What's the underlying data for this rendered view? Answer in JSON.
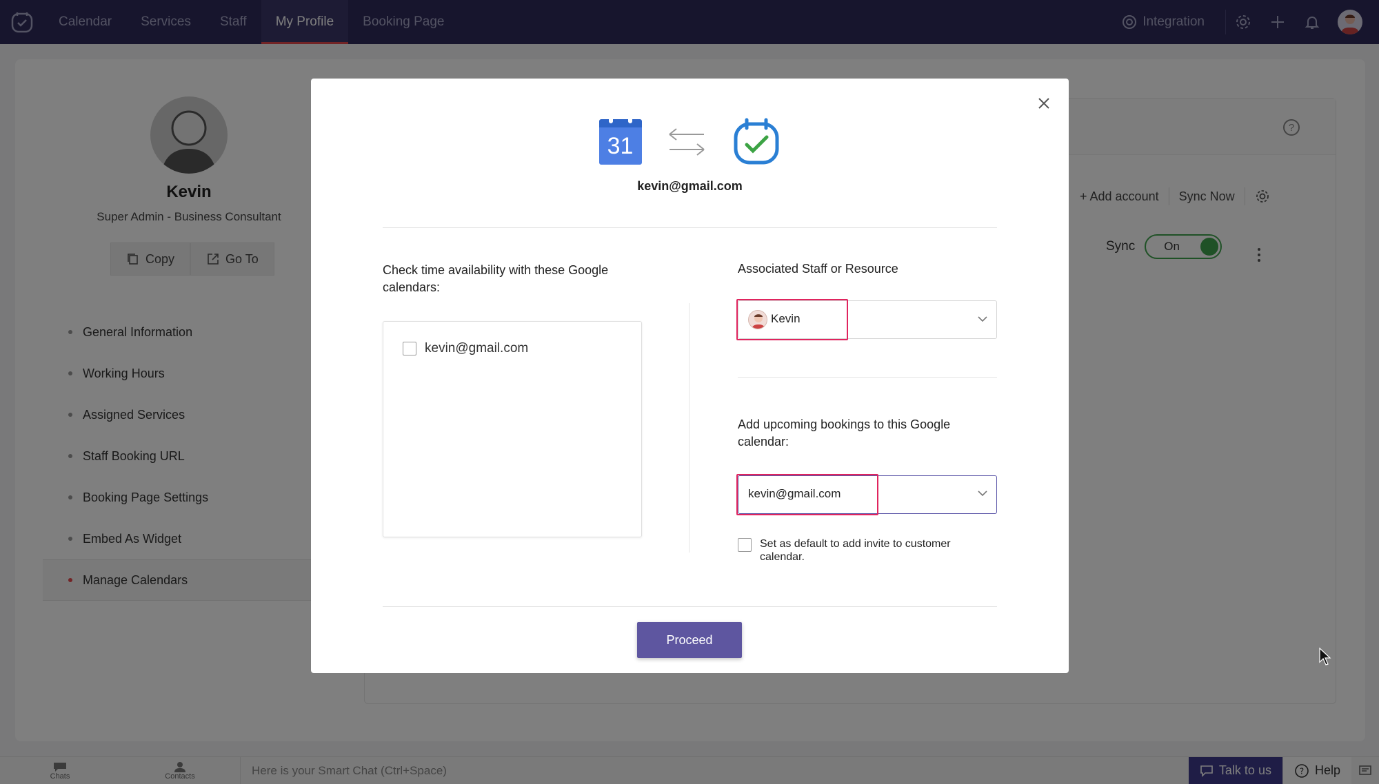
{
  "topnav": {
    "tabs": [
      "Calendar",
      "Services",
      "Staff",
      "My Profile",
      "Booking Page"
    ],
    "active_tab": "My Profile",
    "integration_label": "Integration",
    "icons": [
      "app-logo-icon",
      "integration-icon",
      "gear-icon",
      "plus-icon",
      "bell-icon",
      "avatar"
    ]
  },
  "profile": {
    "name": "Kevin",
    "role": "Super Admin - Business Consultant",
    "copy_label": "Copy",
    "goto_label": "Go To"
  },
  "menu": {
    "items": [
      "General Information",
      "Working Hours",
      "Assigned Services",
      "Staff Booking URL",
      "Booking Page Settings",
      "Embed As Widget",
      "Manage Calendars"
    ],
    "active": "Manage Calendars"
  },
  "calendars_panel": {
    "help_glyph": "?",
    "add_account": "+ Add account",
    "sync_now": "Sync Now",
    "sync_label": "Sync",
    "sync_state": "On"
  },
  "modal": {
    "gcal_day": "31",
    "account_email": "kevin@gmail.com",
    "check_label": "Check time availability with these Google calendars:",
    "calendar_options": [
      "kevin@gmail.com"
    ],
    "staff_label": "Associated Staff or Resource",
    "staff_value": "Kevin",
    "bookings_label": "Add upcoming bookings to this Google calendar:",
    "bookings_value": "kevin@gmail.com",
    "default_invite_label": "Set as default to add invite to customer calendar.",
    "proceed_label": "Proceed"
  },
  "bottombar": {
    "chats": "Chats",
    "contacts": "Contacts",
    "chat_placeholder": "Here is your Smart Chat (Ctrl+Space)",
    "talk": "Talk to us",
    "help": "Help"
  },
  "colors": {
    "nav_bg": "#2e2a5b",
    "accent": "#5e56a0",
    "highlight": "#e0245e",
    "toggle_on": "#3fa34d"
  }
}
